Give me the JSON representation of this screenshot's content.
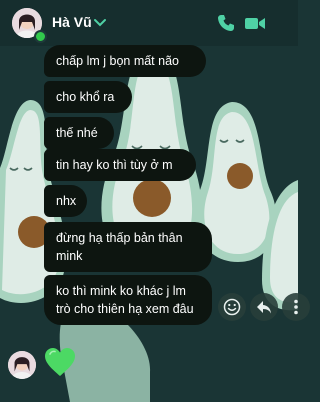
{
  "header": {
    "contact_name": "Hà Vũ",
    "online_color": "#31c94c",
    "accent_color": "#4fd1a5",
    "icons": [
      "chevron-down-icon",
      "phone-icon",
      "video-call-icon"
    ]
  },
  "messages": [
    "chấp lm j bọn mất não",
    "cho khổ ra",
    "thế nhé",
    "tin hay ko thì tùy ở m",
    "nhx",
    "đừng hạ  thấp bản thân mink",
    "ko thì mink ko khác j lm trò cho thiên hạ xem đâu"
  ],
  "last_message": {
    "sticker": "green-heart",
    "color": "#4cd964"
  },
  "message_actions": [
    "emoji-react-icon",
    "reply-icon",
    "more-options-icon"
  ],
  "theme": {
    "wallpaper": "avocado",
    "background": "#1a3535",
    "bubble_color": "#0d1510"
  }
}
